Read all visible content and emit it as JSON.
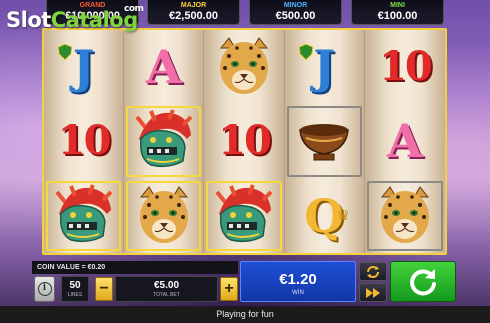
{
  "watermark": {
    "slot": "Slot",
    "catalog": "Catalog",
    "com": "com"
  },
  "jackpots": [
    {
      "name": "GRAND",
      "value": "€10,000.00"
    },
    {
      "name": "MAJOR",
      "value": "€2,500.00"
    },
    {
      "name": "MINOR",
      "value": "€500.00"
    },
    {
      "name": "MINI",
      "value": "€100.00"
    }
  ],
  "reels": [
    [
      "J",
      "10",
      "mayan-mask"
    ],
    [
      "A",
      "mayan-mask",
      "leopard"
    ],
    [
      "leopard",
      "10",
      "mayan-mask"
    ],
    [
      "J",
      "bowl",
      "Q"
    ],
    [
      "10",
      "A",
      "leopard"
    ]
  ],
  "colors": {
    "frame": "#f2d13a",
    "win": "#1f4fd6",
    "spin": "#44d23c"
  },
  "controls": {
    "coin_value": "COIN VALUE = €0.20",
    "lines_value": "50",
    "lines_label": "LINES",
    "minus": "−",
    "plus": "+",
    "bet_value": "€5.00",
    "bet_label": "TOTAL BET",
    "win_value": "€1.20",
    "win_label": "WIN"
  },
  "status": "Playing for fun"
}
